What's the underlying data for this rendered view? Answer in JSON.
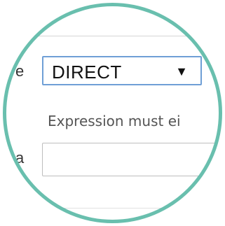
{
  "form": {
    "type_label_fragment": "e",
    "select": {
      "value": "DIRECT",
      "arrow_icon": "caret-down-icon"
    },
    "hint": "Expression must ei",
    "formula_label_fragment": "a",
    "input": {
      "value": "",
      "placeholder": ""
    }
  },
  "colors": {
    "lens_ring": "#69bfae",
    "select_border": "#6f9fd6",
    "input_border": "#bdbdbd",
    "hint_text": "#555555"
  }
}
